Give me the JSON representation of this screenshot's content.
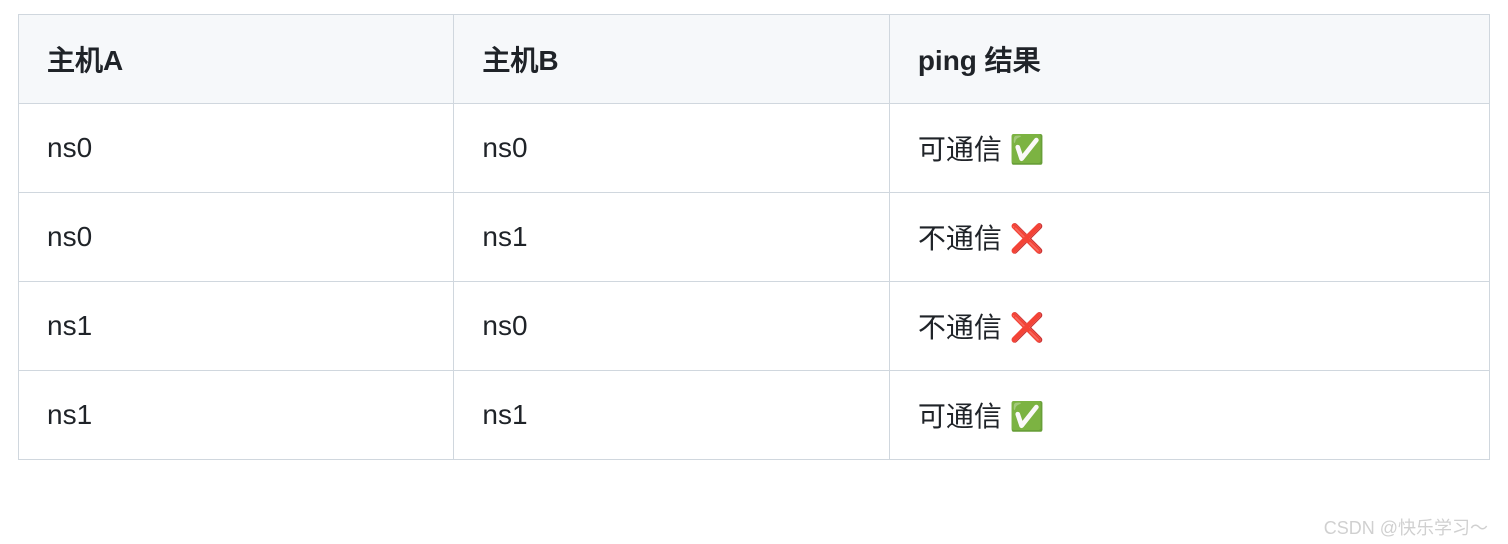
{
  "table": {
    "headers": [
      "主机A",
      "主机B",
      "ping 结果"
    ],
    "rows": [
      {
        "hostA": "ns0",
        "hostB": "ns0",
        "result": "可通信 ✅"
      },
      {
        "hostA": "ns0",
        "hostB": "ns1",
        "result": "不通信 ❌"
      },
      {
        "hostA": "ns1",
        "hostB": "ns0",
        "result": "不通信 ❌"
      },
      {
        "hostA": "ns1",
        "hostB": "ns1",
        "result": "可通信 ✅"
      }
    ]
  },
  "watermark": "CSDN @快乐学习～"
}
